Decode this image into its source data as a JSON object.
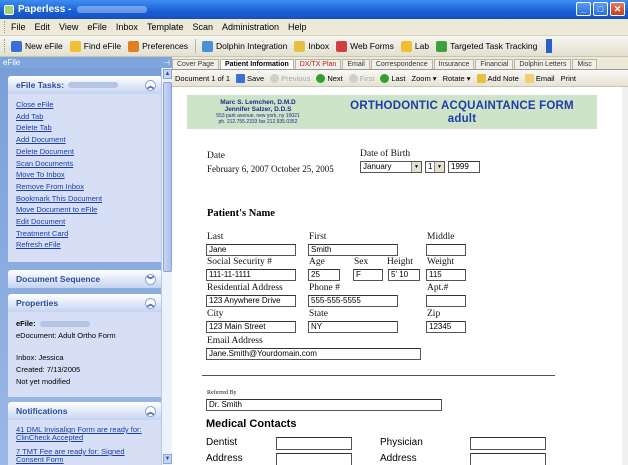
{
  "titlebar": {
    "title": "Paperless - "
  },
  "menu": [
    "File",
    "Edit",
    "View",
    "eFile",
    "Inbox",
    "Template",
    "Scan",
    "Administration",
    "Help"
  ],
  "toolbar": [
    {
      "label": "New eFile",
      "color": "#3a6fd8"
    },
    {
      "label": "Find eFile",
      "color": "#f0c030"
    },
    {
      "label": "Preferences",
      "color": "#e08020"
    },
    {
      "label": "Dolphin Integration",
      "color": "#4a90d8"
    },
    {
      "label": "Inbox",
      "color": "#e8c040"
    },
    {
      "label": "Web Forms",
      "color": "#d04040"
    },
    {
      "label": "Lab",
      "color": "#f0c030"
    },
    {
      "label": "Targeted Task Tracking",
      "color": "#40a040"
    }
  ],
  "left": {
    "header": "eFile",
    "tasks_title": "eFile Tasks:",
    "tasks": [
      "Close eFile",
      "Add Tab",
      "Delete Tab",
      "Add Document",
      "Delete Document",
      "Scan Documents",
      "Move To Inbox",
      "Remove From Inbox",
      "Bookmark This Document",
      "Move Document to eFile",
      "Edit Document",
      "Treatment Card",
      "Refresh eFile"
    ],
    "docseq_title": "Document Sequence",
    "props_title": "Properties",
    "props": {
      "efile_label": "eFile:",
      "edocument": "eDocument: Adult Ortho Form",
      "inbox": "Inbox: Jessica",
      "created": "Created: 7/13/2005",
      "modified": "Not yet modified"
    },
    "notif_title": "Notifications",
    "notifs": [
      "41 DML Invisalign Form are ready for: ClinCheck Accepted",
      "7 TMT Fee are ready for: Signed Consent Form"
    ]
  },
  "tabs": [
    {
      "label": "Cover Page",
      "active": false,
      "red": false
    },
    {
      "label": "Patient Information",
      "active": true,
      "red": false
    },
    {
      "label": "DX/TX Plan",
      "active": false,
      "red": true
    },
    {
      "label": "Email",
      "active": false,
      "red": false
    },
    {
      "label": "Correspondence",
      "active": false,
      "red": false
    },
    {
      "label": "Insurance",
      "active": false,
      "red": false
    },
    {
      "label": "Financial",
      "active": false,
      "red": false
    },
    {
      "label": "Dolphin Letters",
      "active": false,
      "red": false
    },
    {
      "label": "Misc",
      "active": false,
      "red": false
    }
  ],
  "doctoolbar": {
    "doc": "Document 1 of 1",
    "save": "Save",
    "previous": "Previous",
    "next": "Next",
    "first": "First",
    "last": "Last",
    "zoom": "Zoom",
    "rotate": "Rotate",
    "addnote": "Add Note",
    "email": "Email",
    "print": "Print"
  },
  "form": {
    "doctor1": "Marc S. Lemchen, D.M.D",
    "doctor2": "Jennifer Salzer, D.D.S",
    "address": "553 park avenue, new york, ny 10021",
    "phone": "ph. 212.755.2333  fax 212.935.0352",
    "title1": "ORTHODONTIC ACQUAINTANCE FORM",
    "title2": "adult",
    "date_label": "Date",
    "date_value": "February 6, 2007 October 25, 2005",
    "dob_label": "Date of Birth",
    "dob_month": "January",
    "dob_day": "1",
    "dob_year": "1999",
    "section_name": "Patient's Name",
    "last_label": "Last",
    "last": "Jane",
    "first_label": "First",
    "first": "Smith",
    "middle_label": "Middle",
    "middle": "",
    "ssn_label": "Social Security #",
    "ssn": "111-11-1111",
    "age_label": "Age",
    "age": "25",
    "sex_label": "Sex",
    "sex": "F",
    "height_label": "Height",
    "height": "5' 10",
    "weight_label": "Weight",
    "weight": "115",
    "addr_label": "Residential Address",
    "addr": "123 Anywhere Drive",
    "phone_label": "Phone #",
    "phone_val": "555-555-5555",
    "apt_label": "Apt.#",
    "apt": "",
    "city_label": "City",
    "city": "123 Main Street",
    "state_label": "State",
    "state": "NY",
    "zip_label": "Zip",
    "zip": "12345",
    "email_label": "Email Address",
    "email": "Jane.Smith@Yourdomain.com",
    "ref_label": "Referred By",
    "ref": "Dr. Smith",
    "med_title": "Medical Contacts",
    "dentist": "Dentist",
    "physician": "Physician",
    "address1": "Address",
    "address2": "Address"
  }
}
